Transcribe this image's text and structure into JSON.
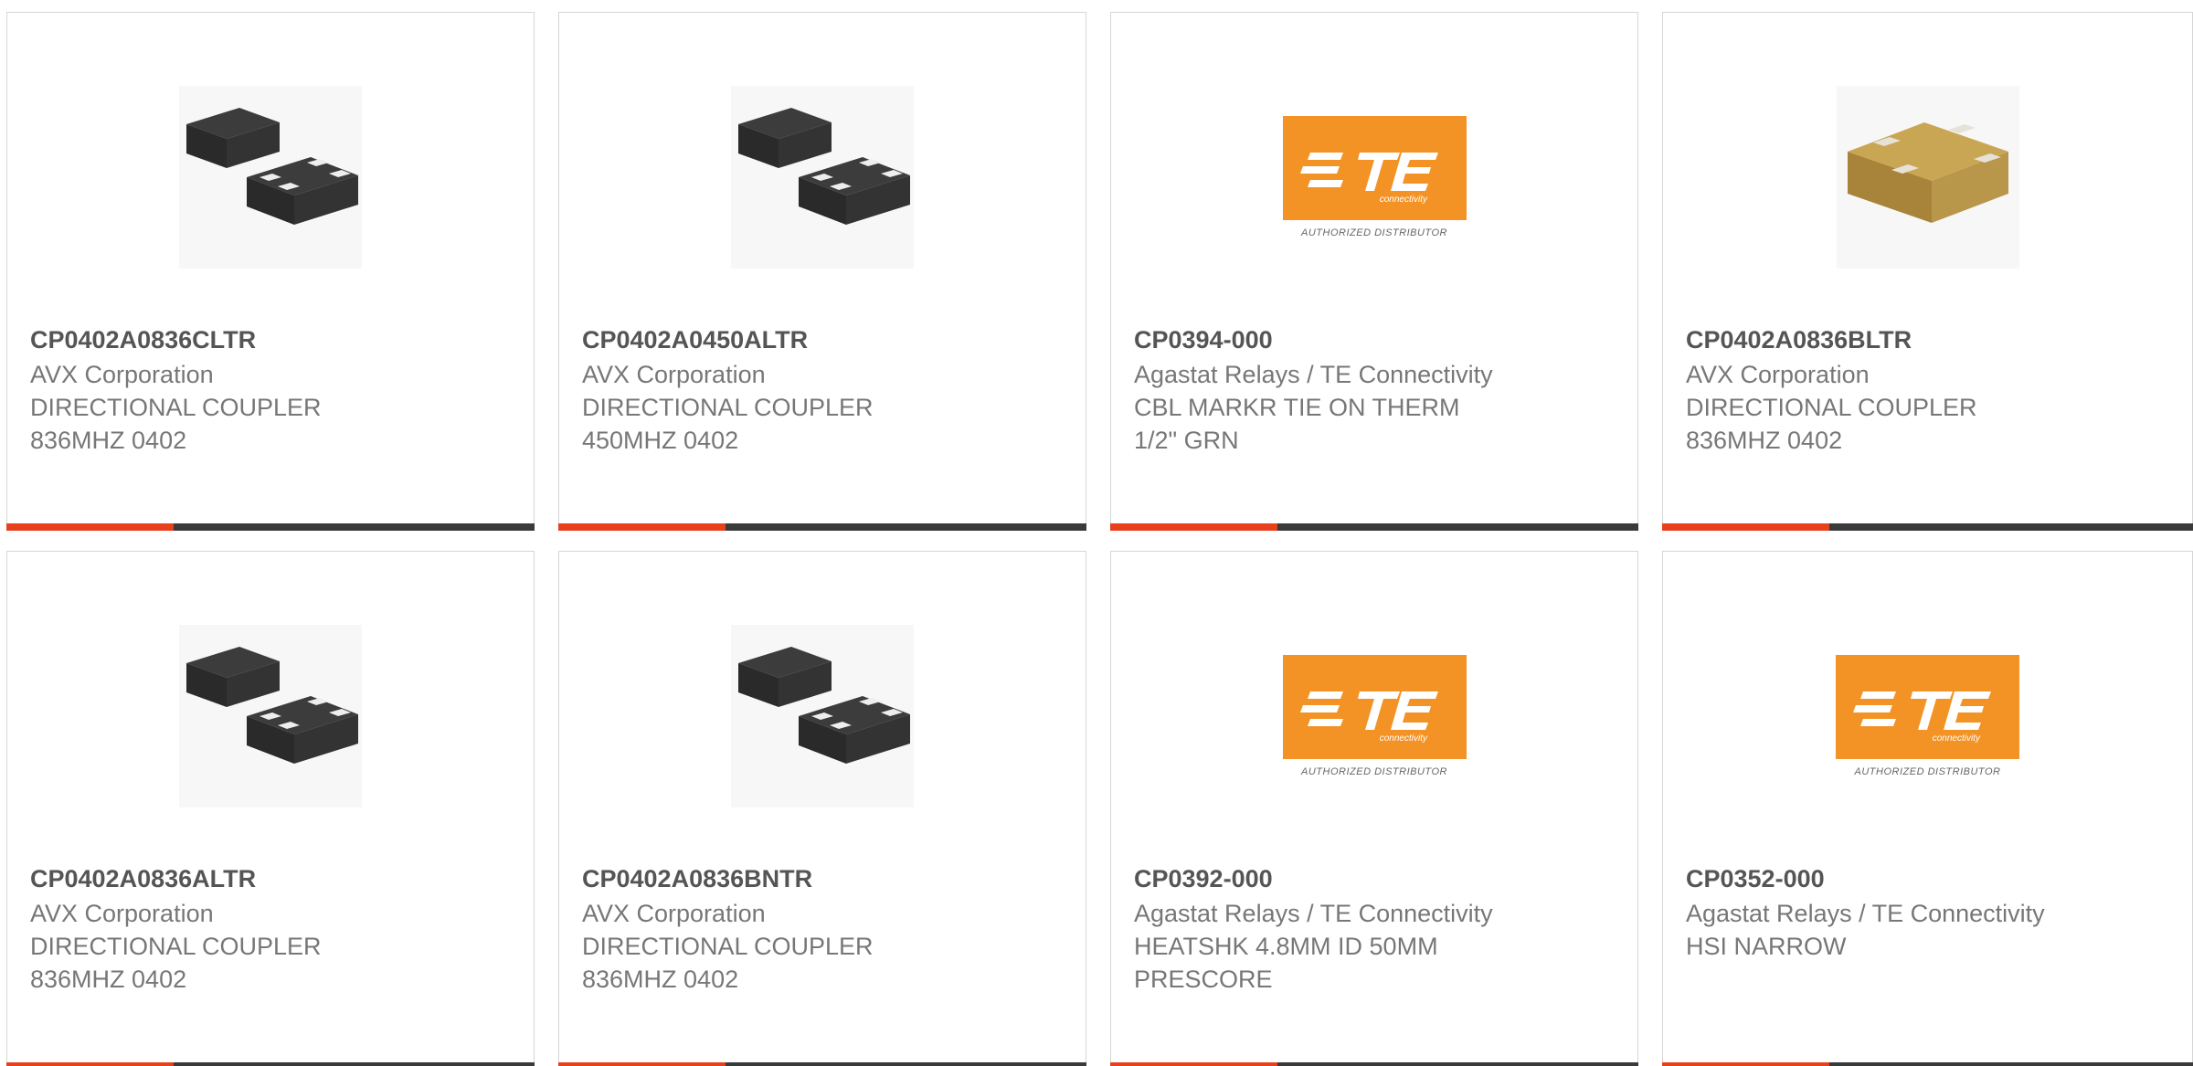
{
  "colors": {
    "accent": "#e8401c",
    "bar": "#3a3a3a",
    "te_orange": "#f39325"
  },
  "products": [
    {
      "part_number": "CP0402A0836CLTR",
      "manufacturer": "AVX Corporation",
      "desc1": "DIRECTIONAL COUPLER",
      "desc2": "836MHZ 0402",
      "image": "chip-dark"
    },
    {
      "part_number": "CP0402A0450ALTR",
      "manufacturer": "AVX Corporation",
      "desc1": "DIRECTIONAL COUPLER",
      "desc2": "450MHZ 0402",
      "image": "chip-dark"
    },
    {
      "part_number": "CP0394-000",
      "manufacturer": "Agastat Relays / TE Connectivity",
      "desc1": "CBL MARKR TIE ON THERM",
      "desc2": "1/2\" GRN",
      "image": "te-logo"
    },
    {
      "part_number": "CP0402A0836BLTR",
      "manufacturer": "AVX Corporation",
      "desc1": "DIRECTIONAL COUPLER",
      "desc2": "836MHZ 0402",
      "image": "chip-gold"
    },
    {
      "part_number": "CP0402A0836ALTR",
      "manufacturer": "AVX Corporation",
      "desc1": "DIRECTIONAL COUPLER",
      "desc2": "836MHZ 0402",
      "image": "chip-dark"
    },
    {
      "part_number": "CP0402A0836BNTR",
      "manufacturer": "AVX Corporation",
      "desc1": "DIRECTIONAL COUPLER",
      "desc2": "836MHZ 0402",
      "image": "chip-dark"
    },
    {
      "part_number": "CP0392-000",
      "manufacturer": "Agastat Relays / TE Connectivity",
      "desc1": "HEATSHK 4.8MM ID 50MM",
      "desc2": "PRESCORE",
      "image": "te-logo"
    },
    {
      "part_number": "CP0352-000",
      "manufacturer": "Agastat Relays / TE Connectivity",
      "desc1": "HSI NARROW",
      "desc2": "",
      "image": "te-logo"
    }
  ],
  "te_logo": {
    "brand": "TE",
    "sub": "connectivity",
    "caption": "AUTHORIZED DISTRIBUTOR"
  }
}
